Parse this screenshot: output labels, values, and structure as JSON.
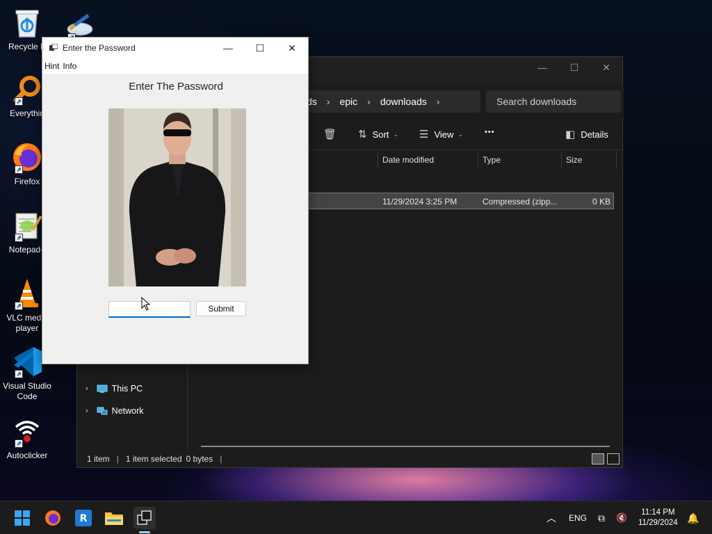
{
  "desktop": {
    "icons": [
      {
        "label": "Recycle B",
        "icon": "recycle-bin-icon"
      },
      {
        "label": "Everythin",
        "icon": "search-magnifier-icon"
      },
      {
        "label": "Firefox",
        "icon": "firefox-icon"
      },
      {
        "label": "Notepad+",
        "icon": "notepad-plus-icon"
      },
      {
        "label": "VLC media player",
        "icon": "vlc-cone-icon"
      },
      {
        "label": "Visual Studio Code",
        "icon": "vscode-icon"
      },
      {
        "label": "Autoclicker",
        "icon": "wifi-power-icon"
      }
    ]
  },
  "explorer": {
    "breadcrumb": [
      "ds",
      "epic",
      "downloads"
    ],
    "search_placeholder": "Search downloads",
    "toolbar": {
      "sort": "Sort",
      "view": "View",
      "more": "•••",
      "details": "Details"
    },
    "columns": [
      "Date modified",
      "Type",
      "Size"
    ],
    "files": [
      {
        "date_modified": "11/29/2024 3:25 PM",
        "type": "Compressed (zipp...",
        "size": "0 KB"
      }
    ],
    "nav": [
      {
        "label": "This PC",
        "icon": "monitor-icon"
      },
      {
        "label": "Network",
        "icon": "network-icon"
      }
    ],
    "status": {
      "count": "1 item",
      "selected": "1 item selected",
      "size": "0 bytes"
    }
  },
  "dialog": {
    "title": "Enter the Password",
    "menu": [
      "Hint",
      "Info"
    ],
    "heading": "Enter The Password",
    "password_value": "",
    "submit_label": "Submit"
  },
  "taskbar": {
    "apps": [
      "windows-start-icon",
      "firefox-icon",
      "remote-desktop-icon",
      "file-explorer-icon",
      "app-window-icon"
    ],
    "language": "ENG",
    "time": "11:14 PM",
    "date": "11/29/2024"
  },
  "colors": {
    "accent": "#0067c0",
    "explorer_bg": "#1c1c1c",
    "dialog_bg": "#f0f0f0"
  }
}
